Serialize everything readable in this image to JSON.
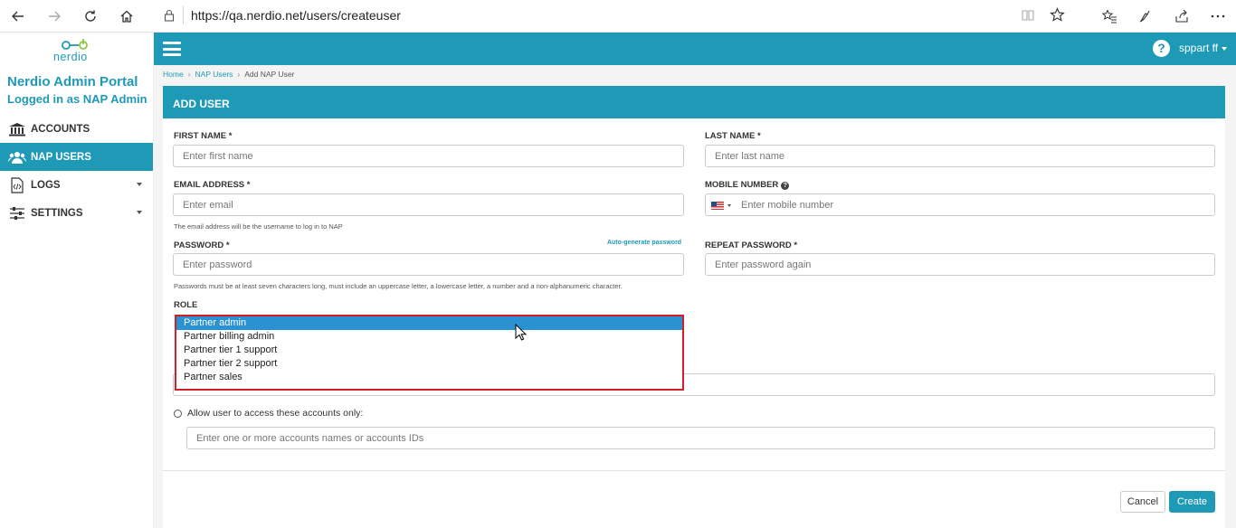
{
  "browser": {
    "url": "https://qa.nerdio.net/users/createuser"
  },
  "sidebar": {
    "logo_text": "nerdio",
    "title": "Nerdio Admin Portal",
    "subtitle": "Logged in as NAP Admin",
    "items": [
      {
        "label": "ACCOUNTS",
        "icon": "bank-icon"
      },
      {
        "label": "NAP USERS",
        "icon": "users-icon"
      },
      {
        "label": "LOGS",
        "icon": "code-file-icon"
      },
      {
        "label": "SETTINGS",
        "icon": "sliders-icon"
      }
    ]
  },
  "header": {
    "user": "sppart ff"
  },
  "breadcrumb": {
    "home": "Home",
    "nap_users": "NAP Users",
    "current": "Add NAP User"
  },
  "form": {
    "title": "ADD USER",
    "first_name_label": "FIRST NAME *",
    "first_name_placeholder": "Enter first name",
    "last_name_label": "LAST NAME *",
    "last_name_placeholder": "Enter last name",
    "email_label": "EMAIL ADDRESS *",
    "email_placeholder": "Enter email",
    "email_help": "The email address will be the username to log in to NAP",
    "mobile_label": "MOBILE NUMBER",
    "mobile_placeholder": "Enter mobile number",
    "password_label": "PASSWORD *",
    "autogen_label": "Auto-generate password",
    "password_placeholder": "Enter password",
    "password_help": "Passwords must be at least seven characters long, must include an uppercase letter, a lowercase letter, a number and a non-alphanumeric character.",
    "repeat_password_label": "REPEAT PASSWORD *",
    "repeat_password_placeholder": "Enter password again",
    "role_label": "ROLE",
    "role_options": [
      "Partner admin",
      "Partner billing admin",
      "Partner tier 1 support",
      "Partner tier 2 support",
      "Partner sales"
    ],
    "role_selected": "Partner admin",
    "allow_accounts_label": "Allow user to access these accounts only:",
    "accounts_placeholder": "Enter one or more accounts names or accounts IDs",
    "cancel_label": "Cancel",
    "create_label": "Create"
  },
  "colors": {
    "brand": "#1e9ab7",
    "highlight_border": "#d0202a",
    "selected_option": "#2a92d0"
  }
}
